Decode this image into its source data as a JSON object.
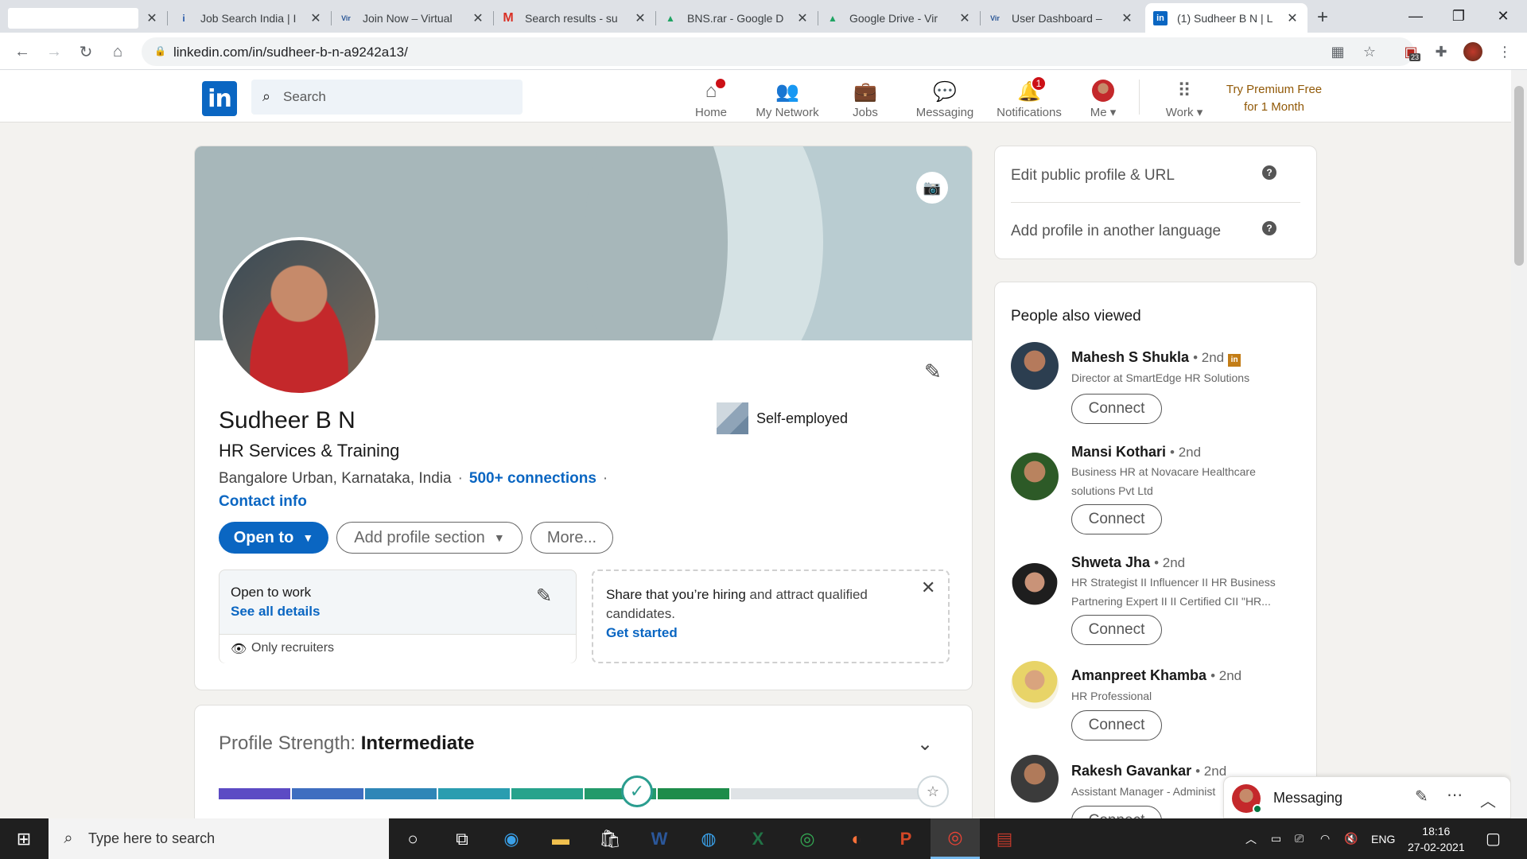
{
  "browser": {
    "tabs": [
      {
        "title": "",
        "favicon": ""
      },
      {
        "title": "Job Search India | I",
        "favicon": "i"
      },
      {
        "title": "Join Now – Virtual",
        "favicon": "Vir"
      },
      {
        "title": "Search results - su",
        "favicon": "M"
      },
      {
        "title": "BNS.rar - Google D",
        "favicon": "drive"
      },
      {
        "title": "Google Drive - Vir",
        "favicon": "drive"
      },
      {
        "title": "User Dashboard –",
        "favicon": "Vir"
      },
      {
        "title": "(1) Sudheer B N | L",
        "favicon": "in",
        "active": true
      }
    ],
    "url": "linkedin.com/in/sudheer-b-n-a9242a13/",
    "extension_badge": "23"
  },
  "linkedin": {
    "logo": "in",
    "search_placeholder": "Search",
    "nav": [
      {
        "label": "Home",
        "icon": "home-icon",
        "badge": ""
      },
      {
        "label": "My Network",
        "icon": "network-icon",
        "badge": ""
      },
      {
        "label": "Jobs",
        "icon": "briefcase-icon",
        "badge": ""
      },
      {
        "label": "Messaging",
        "icon": "messaging-icon",
        "badge": ""
      },
      {
        "label": "Notifications",
        "icon": "bell-icon",
        "badge": "1"
      },
      {
        "label": "Me",
        "icon": "avatar",
        "badge": ""
      },
      {
        "label": "Work",
        "icon": "grid-icon",
        "badge": ""
      }
    ],
    "premium": {
      "line1": "Try Premium Free",
      "line2": "for 1 Month"
    }
  },
  "profile": {
    "name": "Sudheer B N",
    "headline": "HR Services & Training",
    "location": "Bangalore Urban, Karnataka, India",
    "connections": "500+ connections",
    "contact_info": "Contact info",
    "company": "Self-employed",
    "buttons": {
      "open_to": "Open to",
      "add_section": "Add profile section",
      "more": "More..."
    },
    "open_to_work": {
      "title": "Open to work",
      "link": "See all details",
      "visibility": "Only recruiters"
    },
    "hiring": {
      "bold": "Share that you’re hiring",
      "rest": " and attract qualified candidates.",
      "link": "Get started"
    }
  },
  "strength": {
    "label": "Profile Strength: ",
    "level": "Intermediate",
    "progress_fraction": 0.62,
    "segment_colors": [
      "#5c4bc4",
      "#3f6ec0",
      "#2f86b7",
      "#2a9db0",
      "#27a38c",
      "#239a6a",
      "#1d8c4a"
    ]
  },
  "sidebar": {
    "edit_public": "Edit public profile & URL",
    "add_language": "Add profile in another language",
    "people_title": "People also viewed",
    "connect_label": "Connect",
    "people": [
      {
        "name": "Mahesh S Shukla",
        "degree": "• 2nd",
        "desc": "Director at SmartEdge HR Solutions",
        "premium": true
      },
      {
        "name": "Mansi Kothari",
        "degree": "• 2nd",
        "desc": "Business HR at Novacare Healthcare solutions Pvt Ltd"
      },
      {
        "name": "Shweta Jha",
        "degree": "• 2nd",
        "desc": "HR Strategist II Influencer II HR Business Partnering Expert II II Certified CII \"HR..."
      },
      {
        "name": "Amanpreet Khamba",
        "degree": "• 2nd",
        "desc": "HR Professional"
      },
      {
        "name": "Rakesh Gavankar",
        "degree": "• 2nd",
        "desc": "Assistant Manager - Administ"
      }
    ]
  },
  "messaging_bar": {
    "label": "Messaging"
  },
  "taskbar": {
    "search_placeholder": "Type here to search",
    "lang": "ENG",
    "time": "18:16",
    "date": "27-02-2021"
  }
}
